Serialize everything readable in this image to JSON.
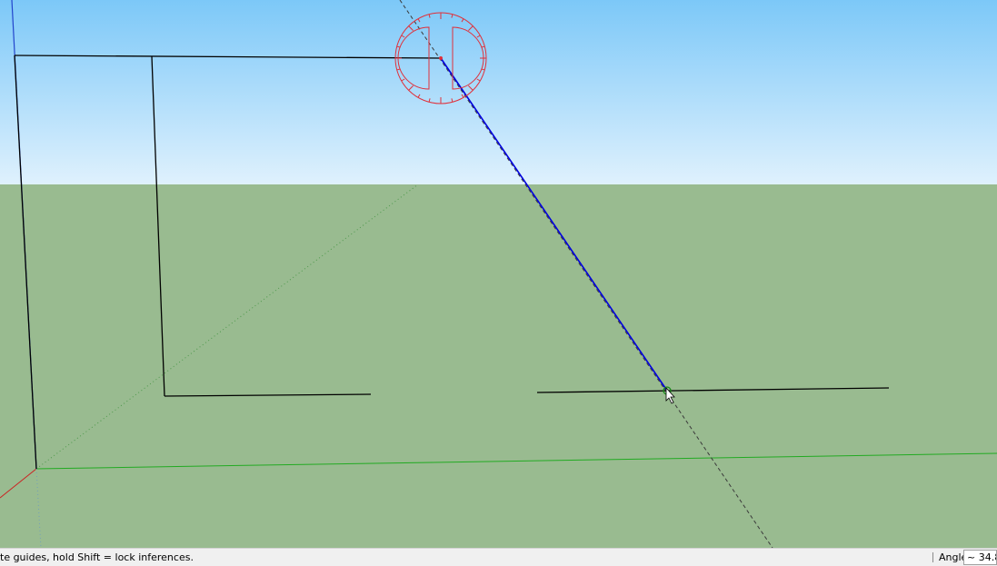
{
  "viewport": {
    "sky_top_color": "#7cc8f8",
    "sky_horizon_color": "#dff1fd",
    "ground_color": "#99bb90",
    "edge_color": "#000000",
    "drawing_line_color": "#0000dd",
    "protractor_color": "#e0303a",
    "guide_color": "#3a3a3a",
    "axis_colors": {
      "red": "#cc2222",
      "green": "#22aa22",
      "blue": "#2244cc"
    },
    "protractor_icon": "protractor-icon",
    "cursor_icon": "protractor-cursor-icon"
  },
  "statusbar": {
    "hint_text": "te guides, hold Shift = lock inferences.",
    "measurement_label": "Angle",
    "measurement_value": "~ 34.8"
  }
}
